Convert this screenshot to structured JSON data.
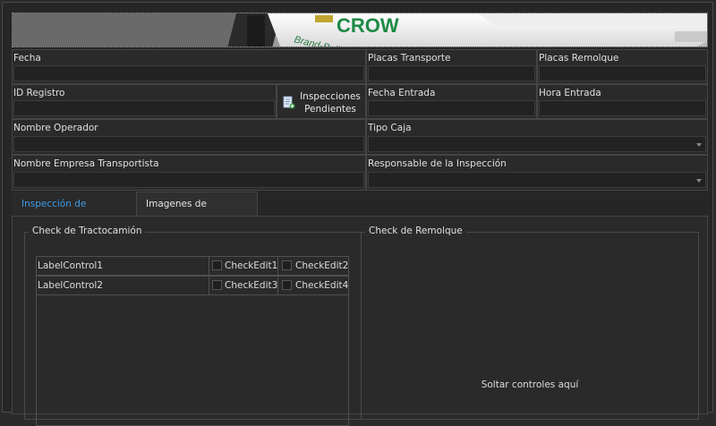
{
  "banner": {
    "logo_text": "CROW",
    "sub_text": "Brand-Buil",
    "logo_color": "#1e8a46"
  },
  "fields": {
    "fecha": "Fecha",
    "placas_transporte": "Placas Transporte",
    "placas_remolque": "Placas Remolque",
    "id_registro": "ID Registro",
    "fecha_entrada": "Fecha Entrada",
    "hora_entrada": "Hora Entrada",
    "nombre_operador": "Nombre Operador",
    "tipo_caja": "Tipo Caja",
    "nombre_empresa": "Nombre Empresa Transportista",
    "responsable": "Responsable de la Inspección"
  },
  "buttons": {
    "inspecciones_line1": "Inspecciones",
    "inspecciones_line2": "Pendientes"
  },
  "tabs": [
    {
      "label": "Inspección de Seguridad",
      "active": true
    },
    {
      "label": "Imagenes de Inspección",
      "active": false
    }
  ],
  "groups": {
    "tractocamion": "Check de Tractocamión",
    "remolque": "Check de Remolque",
    "remolque_placeholder": "Soltar controles aquí"
  },
  "check_rows": [
    {
      "label": "LabelControl1",
      "check_a": "CheckEdit1",
      "check_b": "CheckEdit2"
    },
    {
      "label": "LabelControl2",
      "check_a": "CheckEdit3",
      "check_b": "CheckEdit4"
    }
  ],
  "colors": {
    "active_tab": "#3e9be8",
    "background": "#262626"
  },
  "icons": [
    "document-add-icon",
    "dropdown-arrow-icon",
    "checkbox-icon"
  ]
}
